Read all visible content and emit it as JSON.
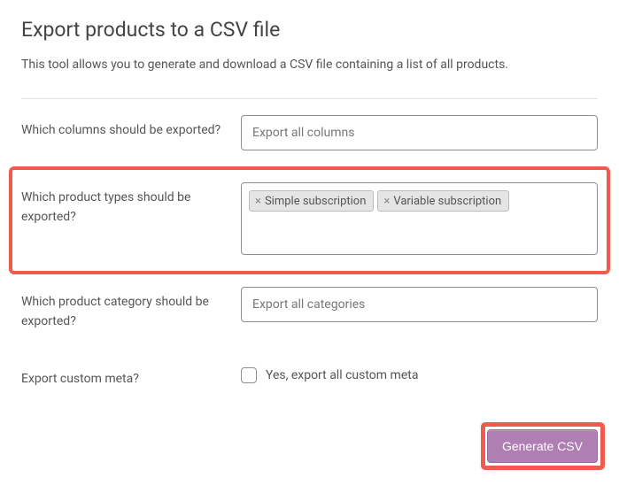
{
  "header": {
    "title": "Export products to a CSV file",
    "description": "This tool allows you to generate and download a CSV file containing a list of all products."
  },
  "form": {
    "columns": {
      "label": "Which columns should be exported?",
      "placeholder": "Export all columns"
    },
    "productTypes": {
      "label": "Which product types should be exported?",
      "tags": {
        "t0": "Simple subscription",
        "t1": "Variable subscription"
      }
    },
    "category": {
      "label": "Which product category should be exported?",
      "placeholder": "Export all categories"
    },
    "customMeta": {
      "label": "Export custom meta?",
      "checkboxLabel": "Yes, export all custom meta"
    }
  },
  "actions": {
    "generate": "Generate CSV"
  }
}
